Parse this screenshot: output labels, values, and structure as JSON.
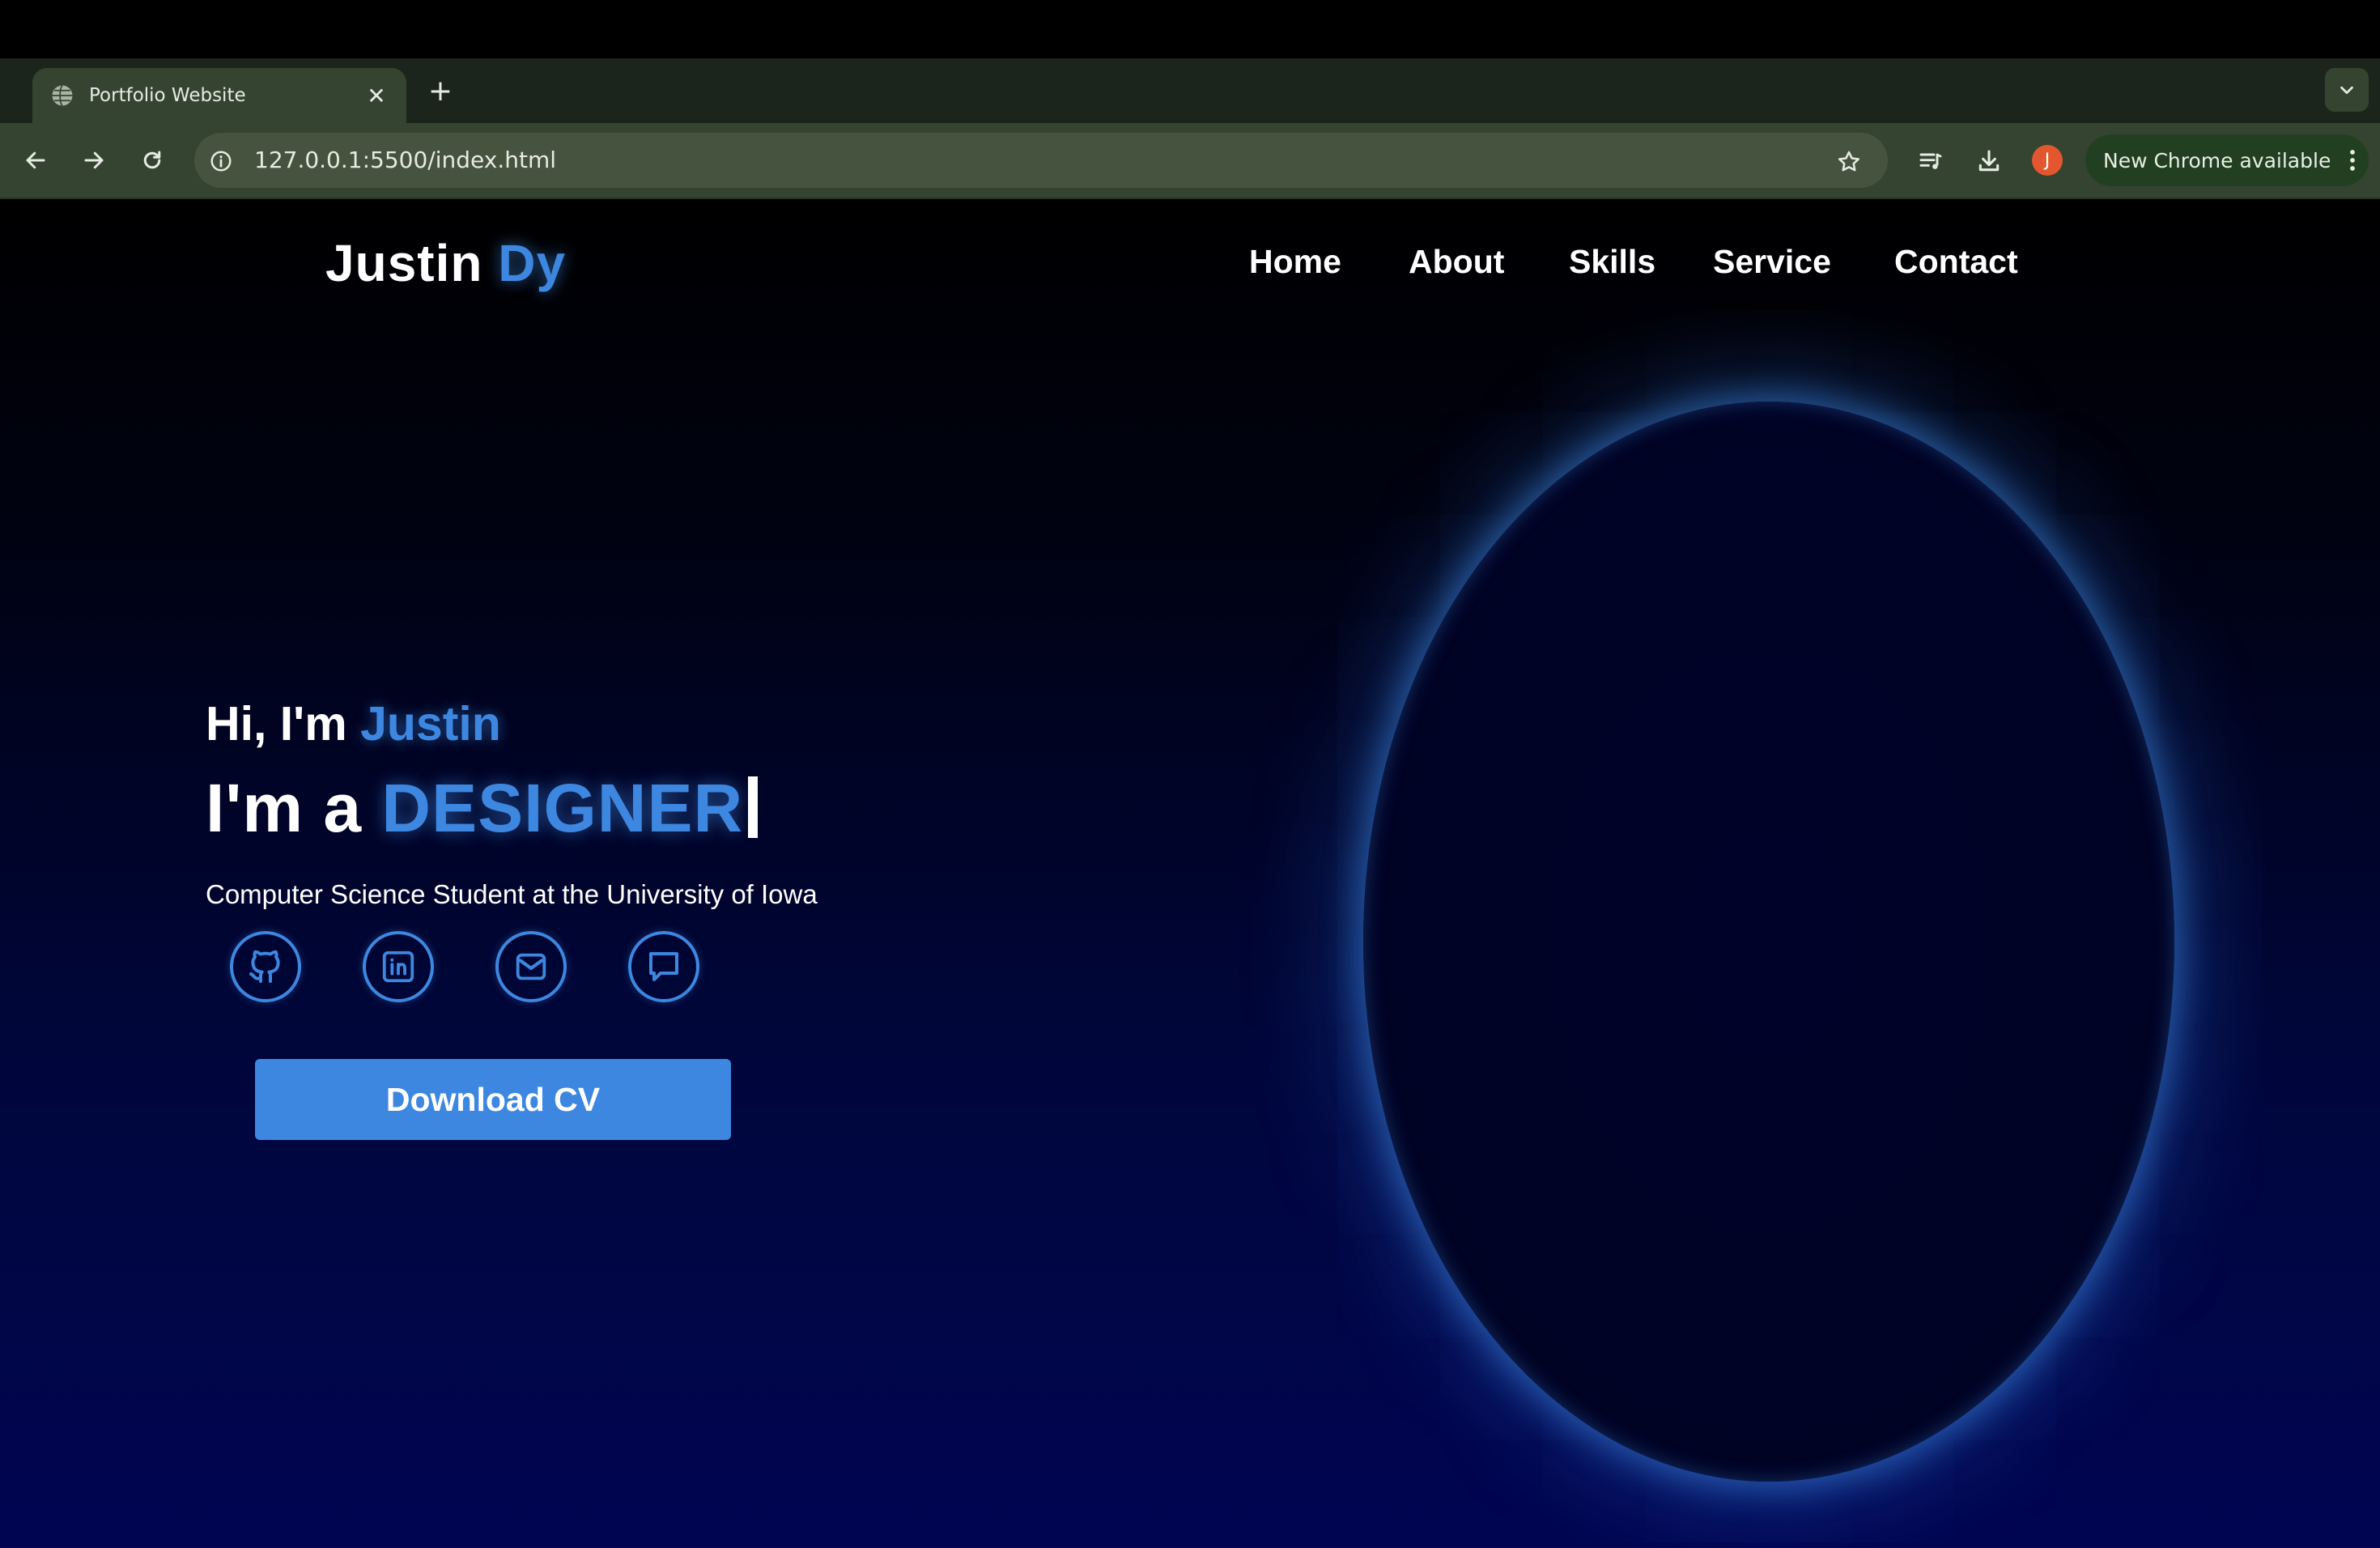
{
  "browser": {
    "tab_title": "Portfolio Website",
    "url": "127.0.0.1:5500/index.html",
    "profile_initial": "J",
    "update_label": "New Chrome available"
  },
  "site": {
    "logo_first": "Justin",
    "logo_accent": "Dy",
    "nav": [
      "Home",
      "About",
      "Skills",
      "Service",
      "Contact"
    ],
    "hero": {
      "greeting_prefix": "Hi, I'm ",
      "greeting_name": "Justin",
      "role_prefix": "I'm a ",
      "role_word": "DESIGNER",
      "subtitle": "Computer Science Student at the University of Iowa",
      "cta": "Download CV"
    },
    "social_icons": [
      "github-icon",
      "linkedin-icon",
      "email-icon",
      "chat-icon"
    ]
  },
  "colors": {
    "accent": "#3d87e0",
    "tab_bar": "#1c251b",
    "toolbar": "#354431",
    "background_top": "#000000",
    "background_bottom": "#000552"
  }
}
